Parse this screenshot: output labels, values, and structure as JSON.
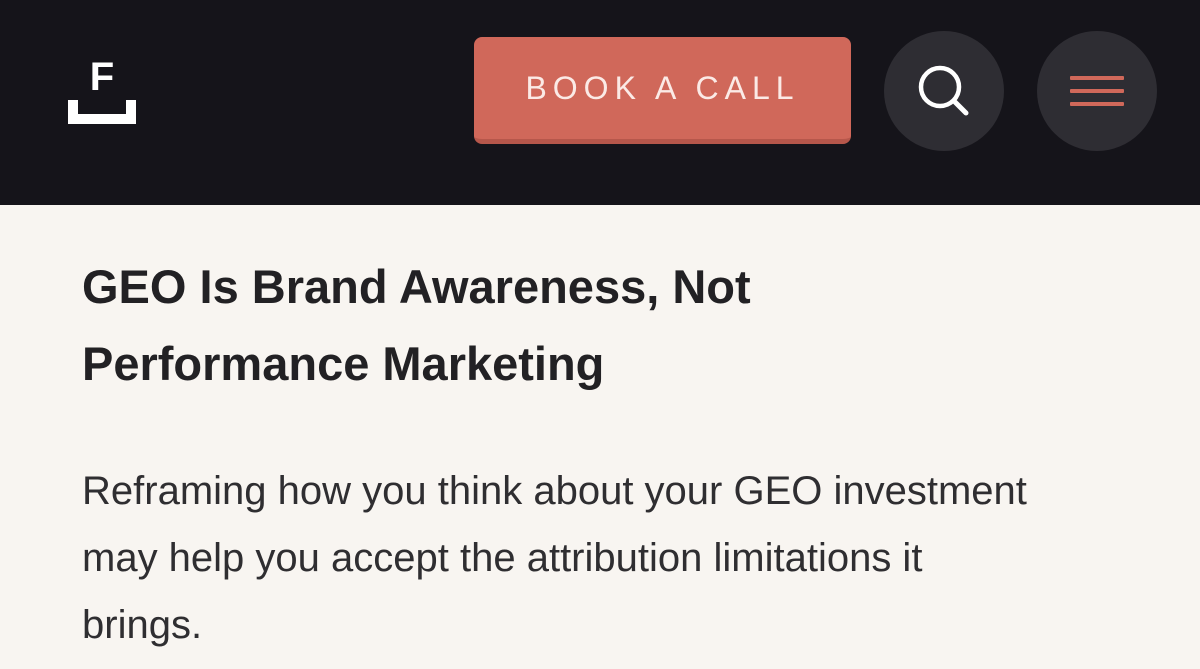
{
  "header": {
    "logo_letter": "F",
    "book_call_label": "BOOK A CALL",
    "search_icon": "search-icon",
    "menu_icon": "hamburger-menu-icon"
  },
  "colors": {
    "header_bg": "#15141a",
    "accent": "#d0685a",
    "icon_button_bg": "#2e2d33",
    "page_bg": "#f8f5f1",
    "text": "#222124"
  },
  "article": {
    "title": "GEO Is Brand Awareness, Not Performance Marketing",
    "subtitle": "Reframing how you think about your GEO investment may help you accept the attribution limitations it brings."
  }
}
